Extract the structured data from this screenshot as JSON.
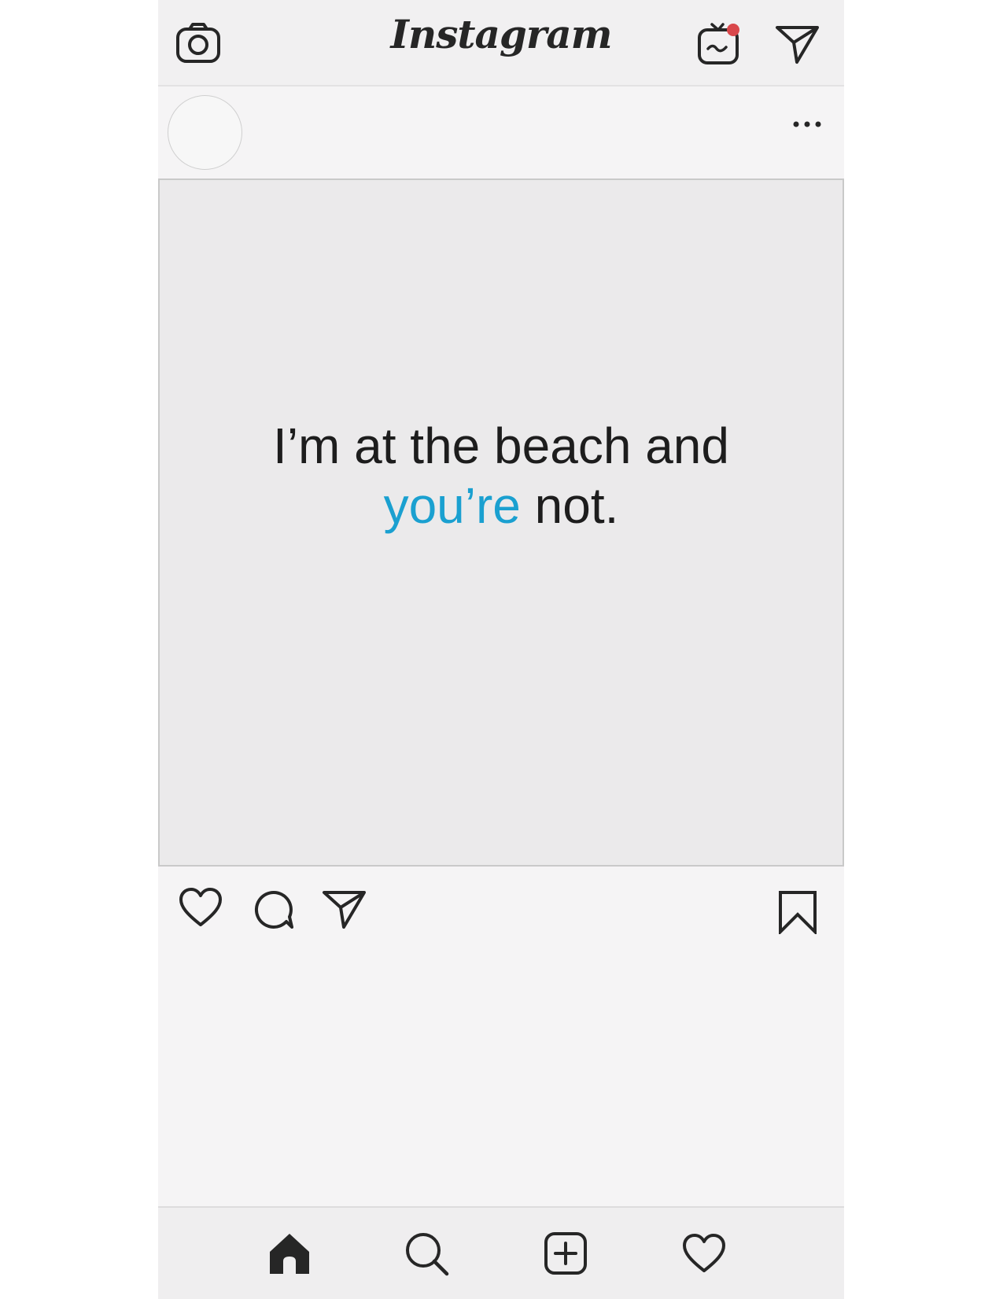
{
  "app": {
    "title": "Instagram"
  },
  "top_bar": {
    "icons": [
      "camera-icon",
      "igtv-icon",
      "direct-message-icon"
    ],
    "notification_dot_color": "#d9474b"
  },
  "post": {
    "header": {
      "more_options": "more-options-icon"
    },
    "caption": {
      "line1": "I’m at the beach and",
      "line2_highlight": "you’re",
      "line2_rest": " not.",
      "highlight_color": "#1aa0d0"
    },
    "actions": [
      "like-icon",
      "comment-icon",
      "share-icon",
      "bookmark-icon"
    ]
  },
  "bottom_nav": {
    "icons": [
      "home-icon",
      "search-icon",
      "new-post-icon",
      "activity-icon"
    ]
  }
}
